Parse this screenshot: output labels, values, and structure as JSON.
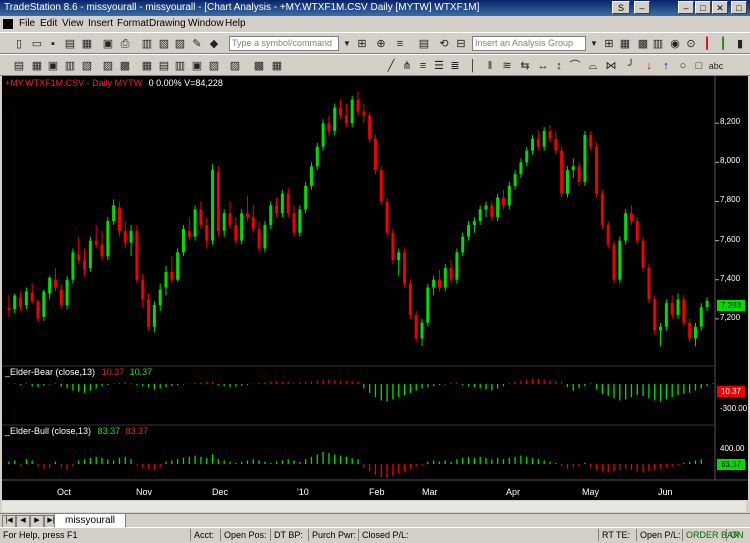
{
  "window": {
    "title": "TradeStation 8.6 - missyourall - missyourall - [Chart Analysis - +MY.WTXF1M.CSV Daily  [MYTW] WTXF1M]",
    "btn_s": "S",
    "btn_min": "–",
    "btn_max": "□",
    "btn_close": "✕"
  },
  "menu": [
    "File",
    "Edit",
    "View",
    "Insert",
    "Format",
    "Drawing",
    "Window",
    "Help"
  ],
  "toolbar": {
    "symbol_placeholder": "Type a symbol/command",
    "analysis_placeholder": "Insert an Analysis Group",
    "text_tool": "abc"
  },
  "chart": {
    "header": "+MY.WTXF1M.CSV - Daily  MYTW",
    "header_values": "0  0.00%  V=84,228",
    "price_labels": [
      "8,200",
      "8,000",
      "7,800",
      "7,600",
      "7,400",
      "7,200"
    ],
    "price_values": [
      8200,
      8000,
      7800,
      7600,
      7400,
      7200
    ],
    "last_price": "7,293",
    "last_price_value": 7293,
    "months": [
      "Oct",
      "Nov",
      "Dec",
      "'10",
      "Feb",
      "Mar",
      "Apr",
      "May",
      "Jun"
    ],
    "colors": {
      "up": "#00dd00",
      "down": "#ee0000",
      "background": "#000000"
    }
  },
  "bear": {
    "label": "_Elder-Bear (close,13)",
    "val1": "10.37",
    "val2": "10.37",
    "axis_label": "-300.00",
    "current": "10.37"
  },
  "bull": {
    "label": "_Elder-Bull (close,13)",
    "val1": "83.37",
    "val2": "83.37",
    "axis_label": "400.00",
    "current": "83.37"
  },
  "tabs": {
    "workspace": "missyourall"
  },
  "status": {
    "help": "For Help, press F1",
    "acct": "Acct:",
    "open_pos": "Open Pos:",
    "dt_bp": "DT BP:",
    "purch_pwr": "Purch Pwr:",
    "closed_pl": "Closed P/L:",
    "rt_te": "RT TE:",
    "open_pl": "Open P/L:",
    "order_bar": "ORDER BAR",
    "on": "ON"
  },
  "chart_data": {
    "type": "candlestick",
    "ylim": [
      7000,
      8380
    ],
    "candles": [
      [
        7255,
        7320,
        7210,
        7245
      ],
      [
        7250,
        7330,
        7230,
        7320
      ],
      [
        7310,
        7340,
        7240,
        7260
      ],
      [
        7270,
        7360,
        7250,
        7340
      ],
      [
        7335,
        7380,
        7280,
        7290
      ],
      [
        7290,
        7300,
        7180,
        7200
      ],
      [
        7210,
        7350,
        7190,
        7340
      ],
      [
        7330,
        7420,
        7300,
        7410
      ],
      [
        7400,
        7460,
        7340,
        7360
      ],
      [
        7350,
        7380,
        7250,
        7270
      ],
      [
        7270,
        7420,
        7250,
        7400
      ],
      [
        7400,
        7560,
        7380,
        7540
      ],
      [
        7530,
        7620,
        7480,
        7500
      ],
      [
        7500,
        7560,
        7420,
        7450
      ],
      [
        7460,
        7620,
        7440,
        7600
      ],
      [
        7600,
        7680,
        7560,
        7580
      ],
      [
        7580,
        7650,
        7500,
        7520
      ],
      [
        7520,
        7720,
        7500,
        7700
      ],
      [
        7700,
        7810,
        7680,
        7780
      ],
      [
        7770,
        7800,
        7620,
        7650
      ],
      [
        7650,
        7700,
        7560,
        7590
      ],
      [
        7590,
        7680,
        7520,
        7650
      ],
      [
        7650,
        7680,
        7380,
        7400
      ],
      [
        7400,
        7430,
        7260,
        7300
      ],
      [
        7300,
        7330,
        7140,
        7160
      ],
      [
        7160,
        7290,
        7130,
        7270
      ],
      [
        7270,
        7380,
        7240,
        7350
      ],
      [
        7360,
        7470,
        7320,
        7440
      ],
      [
        7440,
        7520,
        7380,
        7400
      ],
      [
        7400,
        7560,
        7390,
        7540
      ],
      [
        7540,
        7680,
        7520,
        7660
      ],
      [
        7650,
        7720,
        7600,
        7620
      ],
      [
        7620,
        7780,
        7600,
        7760
      ],
      [
        7760,
        7800,
        7660,
        7680
      ],
      [
        7680,
        7720,
        7560,
        7600
      ],
      [
        7600,
        7990,
        7580,
        7960
      ],
      [
        7950,
        7980,
        7620,
        7650
      ],
      [
        7650,
        7760,
        7620,
        7740
      ],
      [
        7740,
        7800,
        7660,
        7680
      ],
      [
        7680,
        7720,
        7580,
        7600
      ],
      [
        7600,
        7760,
        7580,
        7740
      ],
      [
        7740,
        7830,
        7700,
        7720
      ],
      [
        7720,
        7780,
        7640,
        7660
      ],
      [
        7660,
        7700,
        7540,
        7560
      ],
      [
        7560,
        7700,
        7540,
        7680
      ],
      [
        7680,
        7800,
        7660,
        7780
      ],
      [
        7780,
        7820,
        7720,
        7740
      ],
      [
        7740,
        7860,
        7720,
        7840
      ],
      [
        7840,
        7870,
        7720,
        7740
      ],
      [
        7740,
        7780,
        7620,
        7640
      ],
      [
        7640,
        7780,
        7620,
        7760
      ],
      [
        7760,
        7900,
        7740,
        7880
      ],
      [
        7880,
        8000,
        7860,
        7980
      ],
      [
        7980,
        8100,
        7960,
        8080
      ],
      [
        8080,
        8220,
        8060,
        8200
      ],
      [
        8200,
        8240,
        8140,
        8160
      ],
      [
        8160,
        8300,
        8140,
        8280
      ],
      [
        8280,
        8320,
        8220,
        8240
      ],
      [
        8240,
        8300,
        8180,
        8200
      ],
      [
        8200,
        8340,
        8180,
        8320
      ],
      [
        8320,
        8360,
        8240,
        8260
      ],
      [
        8260,
        8300,
        8200,
        8240
      ],
      [
        8240,
        8260,
        8100,
        8120
      ],
      [
        8120,
        8140,
        7940,
        7960
      ],
      [
        7960,
        7980,
        7780,
        7800
      ],
      [
        7800,
        7820,
        7620,
        7640
      ],
      [
        7640,
        7660,
        7480,
        7500
      ],
      [
        7500,
        7560,
        7420,
        7540
      ],
      [
        7540,
        7560,
        7360,
        7380
      ],
      [
        7380,
        7400,
        7200,
        7220
      ],
      [
        7220,
        7240,
        7080,
        7100
      ],
      [
        7100,
        7200,
        7060,
        7180
      ],
      [
        7180,
        7380,
        7160,
        7360
      ],
      [
        7360,
        7420,
        7320,
        7400
      ],
      [
        7400,
        7450,
        7340,
        7360
      ],
      [
        7360,
        7480,
        7340,
        7460
      ],
      [
        7460,
        7500,
        7380,
        7400
      ],
      [
        7400,
        7560,
        7380,
        7540
      ],
      [
        7540,
        7640,
        7520,
        7620
      ],
      [
        7620,
        7700,
        7600,
        7680
      ],
      [
        7680,
        7720,
        7640,
        7700
      ],
      [
        7700,
        7780,
        7680,
        7760
      ],
      [
        7760,
        7800,
        7720,
        7780
      ],
      [
        7780,
        7800,
        7700,
        7720
      ],
      [
        7720,
        7840,
        7700,
        7820
      ],
      [
        7820,
        7860,
        7760,
        7780
      ],
      [
        7780,
        7900,
        7760,
        7880
      ],
      [
        7880,
        7960,
        7860,
        7940
      ],
      [
        7940,
        8020,
        7920,
        8000
      ],
      [
        8000,
        8080,
        7980,
        8060
      ],
      [
        8060,
        8140,
        8040,
        8120
      ],
      [
        8120,
        8160,
        8060,
        8080
      ],
      [
        8080,
        8180,
        8060,
        8160
      ],
      [
        8160,
        8190,
        8100,
        8120
      ],
      [
        8120,
        8160,
        8040,
        8060
      ],
      [
        8060,
        8080,
        7820,
        7840
      ],
      [
        7840,
        7980,
        7820,
        7960
      ],
      [
        7960,
        8020,
        7920,
        7980
      ],
      [
        7980,
        8000,
        7880,
        7900
      ],
      [
        7900,
        8160,
        7880,
        8140
      ],
      [
        8140,
        8160,
        8060,
        8080
      ],
      [
        8080,
        8100,
        7820,
        7840
      ],
      [
        7840,
        7860,
        7660,
        7680
      ],
      [
        7680,
        7700,
        7560,
        7580
      ],
      [
        7580,
        7600,
        7380,
        7400
      ],
      [
        7400,
        7620,
        7380,
        7600
      ],
      [
        7600,
        7760,
        7580,
        7740
      ],
      [
        7740,
        7780,
        7680,
        7700
      ],
      [
        7700,
        7720,
        7580,
        7600
      ],
      [
        7600,
        7620,
        7440,
        7460
      ],
      [
        7460,
        7480,
        7280,
        7300
      ],
      [
        7300,
        7320,
        7120,
        7140
      ],
      [
        7140,
        7180,
        7060,
        7160
      ],
      [
        7160,
        7300,
        7140,
        7280
      ],
      [
        7280,
        7320,
        7200,
        7220
      ],
      [
        7220,
        7330,
        7200,
        7300
      ],
      [
        7300,
        7320,
        7160,
        7180
      ],
      [
        7180,
        7200,
        7080,
        7100
      ],
      [
        7100,
        7180,
        7060,
        7160
      ],
      [
        7160,
        7280,
        7140,
        7260
      ],
      [
        7260,
        7310,
        7240,
        7293
      ]
    ],
    "bear_values": [
      5,
      8,
      -10,
      12,
      -20,
      -30,
      -15,
      -5,
      10,
      -25,
      -40,
      -60,
      -70,
      -80,
      -60,
      -40,
      -20,
      -10,
      5,
      10,
      15,
      8,
      -10,
      -20,
      -30,
      -50,
      -40,
      -30,
      -20,
      -10,
      -5,
      5,
      10,
      15,
      20,
      18,
      -10,
      -20,
      -30,
      -25,
      -15,
      -10,
      5,
      10,
      15,
      20,
      25,
      22,
      18,
      10,
      15,
      20,
      25,
      30,
      35,
      40,
      35,
      30,
      28,
      25,
      20,
      -40,
      -80,
      -120,
      -150,
      -160,
      -140,
      -120,
      -100,
      -80,
      -60,
      -40,
      -30,
      -20,
      -10,
      -5,
      10,
      15,
      -10,
      -20,
      -30,
      -40,
      -50,
      -60,
      -40,
      -20,
      10,
      20,
      30,
      40,
      50,
      45,
      40,
      30,
      25,
      20,
      -30,
      -60,
      -40,
      -20,
      10,
      -50,
      -90,
      -110,
      -130,
      -150,
      -140,
      -120,
      -100,
      -110,
      -130,
      -150,
      -160,
      -140,
      -120,
      -100,
      -90,
      -80,
      -60,
      -40,
      -20,
      10
    ],
    "bull_values": [
      20,
      30,
      -10,
      40,
      30,
      -20,
      -40,
      -30,
      20,
      -30,
      -50,
      -20,
      30,
      40,
      50,
      60,
      50,
      40,
      30,
      50,
      60,
      40,
      -10,
      -30,
      -40,
      -50,
      -30,
      20,
      30,
      40,
      50,
      60,
      70,
      60,
      50,
      80,
      40,
      30,
      20,
      10,
      20,
      30,
      40,
      30,
      20,
      10,
      20,
      30,
      40,
      30,
      20,
      40,
      60,
      80,
      100,
      90,
      80,
      70,
      60,
      50,
      40,
      -30,
      -60,
      -90,
      -110,
      -120,
      -100,
      -80,
      -60,
      -40,
      -20,
      -10,
      20,
      30,
      20,
      30,
      20,
      40,
      50,
      60,
      50,
      60,
      50,
      40,
      50,
      40,
      50,
      60,
      70,
      60,
      50,
      40,
      30,
      20,
      10,
      -20,
      -40,
      -30,
      -20,
      10,
      -30,
      -50,
      -60,
      -70,
      -60,
      -50,
      -40,
      -50,
      -60,
      -70,
      -60,
      -50,
      -40,
      -30,
      -20,
      -10,
      10,
      20,
      30,
      40
    ]
  }
}
